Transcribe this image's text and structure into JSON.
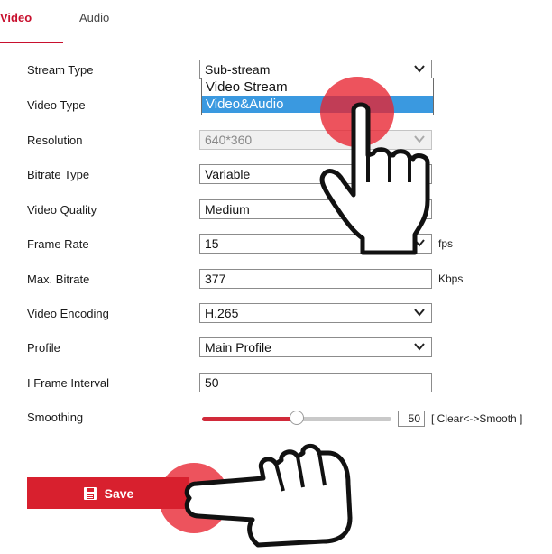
{
  "tabs": {
    "video": "Video",
    "audio": "Audio"
  },
  "form": {
    "stream_type": {
      "label": "Stream Type",
      "value": "Sub-stream"
    },
    "video_type": {
      "label": "Video Type"
    },
    "resolution": {
      "label": "Resolution",
      "value": "640*360"
    },
    "bitrate_type": {
      "label": "Bitrate Type",
      "value": "Variable"
    },
    "video_quality": {
      "label": "Video Quality",
      "value": "Medium"
    },
    "frame_rate": {
      "label": "Frame Rate",
      "value": "15",
      "unit": "fps"
    },
    "max_bitrate": {
      "label": "Max. Bitrate",
      "value": "377",
      "unit": "Kbps"
    },
    "video_encoding": {
      "label": "Video Encoding",
      "value": "H.265"
    },
    "profile": {
      "label": "Profile",
      "value": "Main Profile"
    },
    "i_frame_interval": {
      "label": "I Frame Interval",
      "value": "50"
    },
    "smoothing": {
      "label": "Smoothing",
      "value": "50",
      "hint": "[ Clear<->Smooth ]",
      "level": 0.5
    }
  },
  "video_type_dropdown": {
    "options": [
      "Video Stream",
      "Video&Audio"
    ],
    "selected": "Video&Audio"
  },
  "save": {
    "label": "Save"
  },
  "colors": {
    "accent": "#c8102e",
    "button": "#d8202e",
    "highlight": "#3a99e0"
  }
}
